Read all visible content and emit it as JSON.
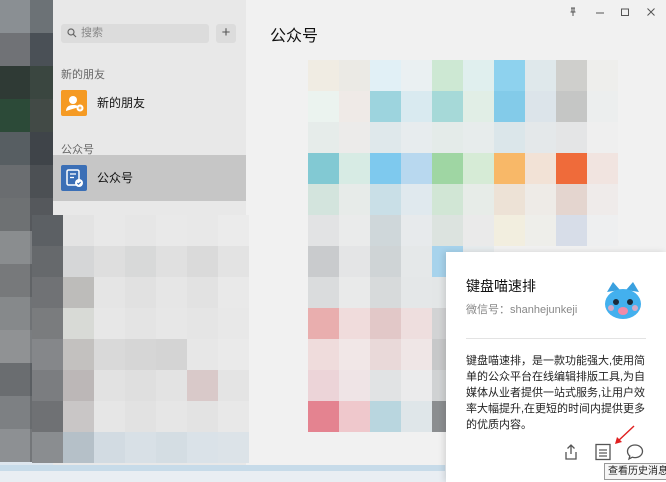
{
  "window": {
    "pin_icon": "pin-icon",
    "minimize_icon": "minimize-icon",
    "maximize_icon": "maximize-icon",
    "close_icon": "close-icon"
  },
  "sidebar": {
    "search_placeholder": "搜索",
    "add_label": "+",
    "section_new_friends": "新的朋友",
    "new_friends_label": "新的朋友",
    "section_official": "公众号",
    "official_label": "公众号",
    "accent_color": "#f59a23",
    "official_icon_color": "#3b6fb6"
  },
  "main": {
    "title": "公众号"
  },
  "card": {
    "name": "键盘喵速排",
    "wechat_id": "微信号：shanhejunkeji",
    "description": "键盘喵速排，是一款功能强大,使用简单的公众平台在线编辑排版工具,为自媒体从业者提供一站式服务,让用户效率大幅提升,在更短的时间内提供更多的优质内容。",
    "share_icon": "share-icon",
    "history_icon": "history-messages-icon",
    "chat_icon": "chat-bubble-icon",
    "tooltip": "查看历史消息"
  }
}
